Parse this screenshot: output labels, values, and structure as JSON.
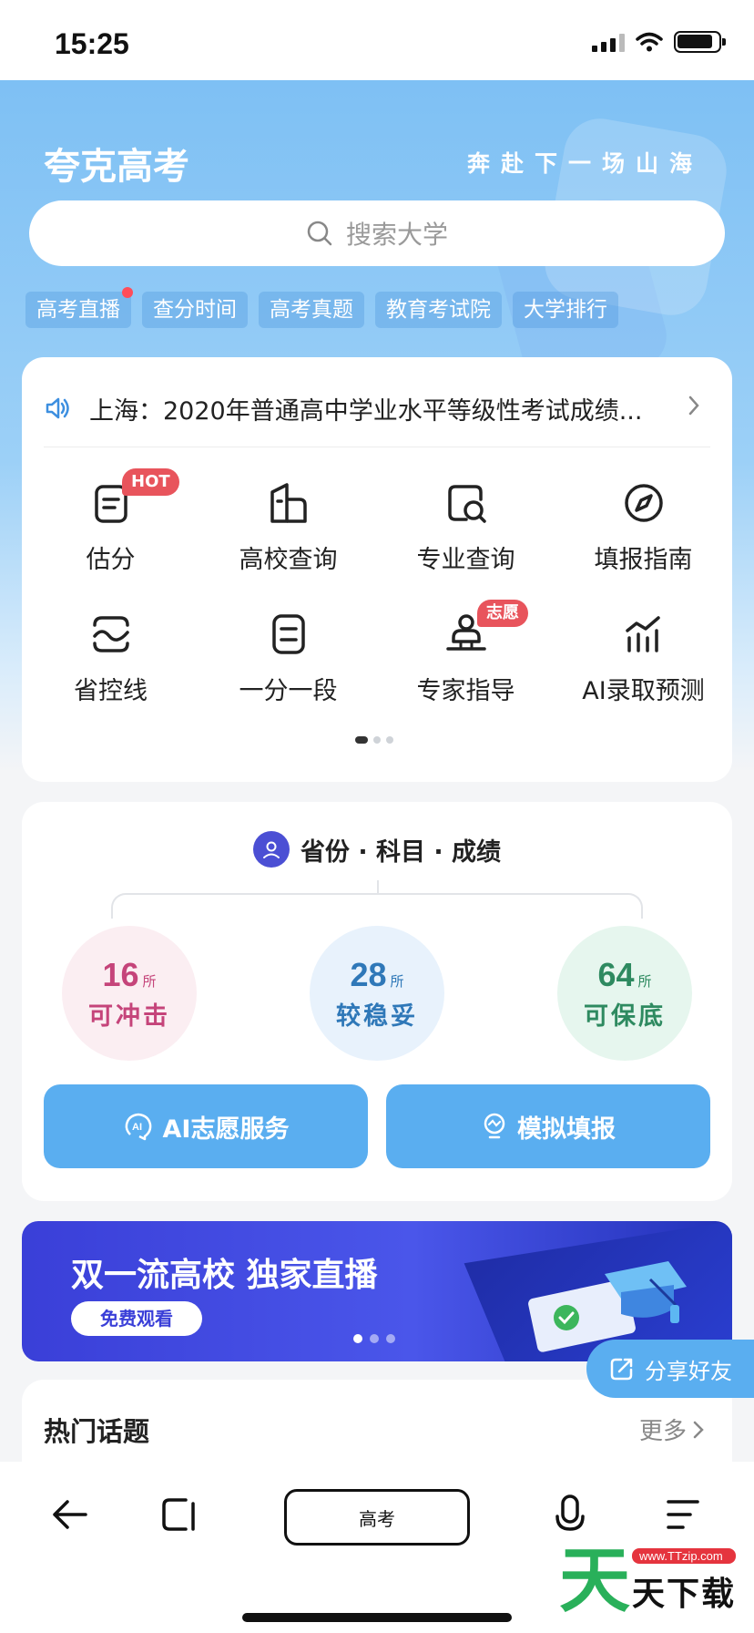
{
  "status_bar": {
    "time": "15:25"
  },
  "header": {
    "app_title": "夸克高考",
    "slogan": "奔赴下一场山海",
    "search_placeholder": "搜索大学"
  },
  "tags": [
    {
      "label": "高考直播",
      "has_dot": true
    },
    {
      "label": "查分时间"
    },
    {
      "label": "高考真题"
    },
    {
      "label": "教育考试院"
    },
    {
      "label": "大学排行"
    }
  ],
  "notice": {
    "text": "上海：2020年普通高中学业水平等级性考试成绩..."
  },
  "grid": [
    {
      "label": "估分",
      "icon": "estimate-icon",
      "badge": "HOT"
    },
    {
      "label": "高校查询",
      "icon": "university-icon"
    },
    {
      "label": "专业查询",
      "icon": "major-search-icon"
    },
    {
      "label": "填报指南",
      "icon": "compass-icon"
    },
    {
      "label": "省控线",
      "icon": "score-line-icon"
    },
    {
      "label": "一分一段",
      "icon": "score-segment-icon"
    },
    {
      "label": "专家指导",
      "icon": "expert-icon",
      "badge": "志愿"
    },
    {
      "label": "AI录取预测",
      "icon": "chart-icon"
    }
  ],
  "recommend": {
    "profile_label": "省份 · 科目 · 成绩",
    "unit": "所",
    "rush": {
      "count": "16",
      "label": "可冲击"
    },
    "stable": {
      "count": "28",
      "label": "较稳妥"
    },
    "safe": {
      "count": "64",
      "label": "可保底"
    },
    "ai_button": "AI志愿服务",
    "sim_button": "模拟填报"
  },
  "banner": {
    "title": "双一流高校 独家直播",
    "button": "免费观看"
  },
  "share": {
    "label": "分享好友"
  },
  "hot_topics": {
    "title": "热门话题",
    "more": "更多"
  },
  "toolbar": {
    "center_label": "高考"
  },
  "watermark": {
    "big": "天",
    "url": "www.TTzip.com",
    "text": "天下载"
  },
  "colors": {
    "accent": "#5aaef0",
    "badge_red": "#e8545c",
    "banner": "#3a3fd8"
  }
}
